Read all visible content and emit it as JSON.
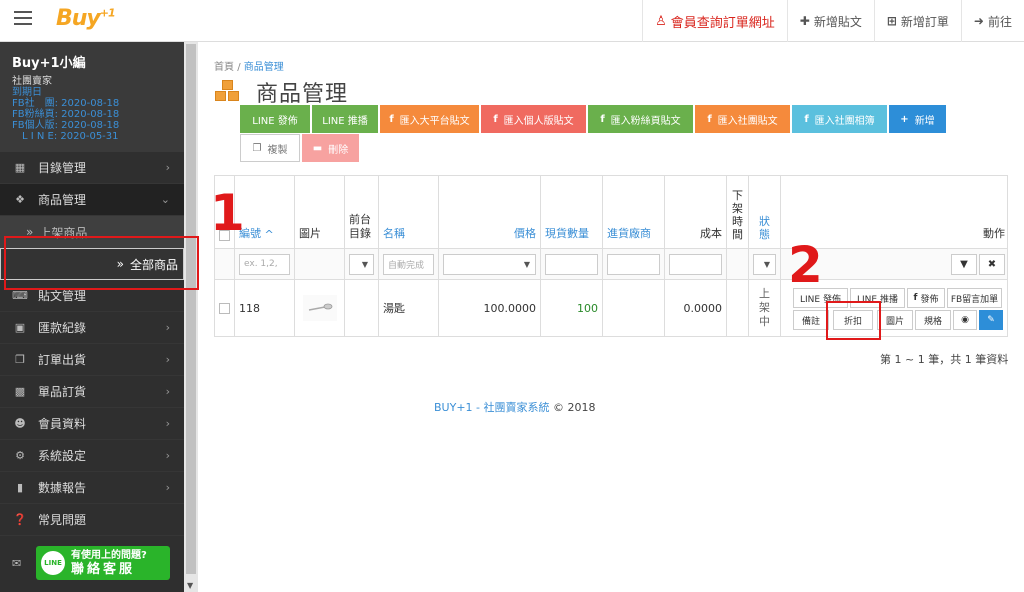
{
  "topbar": {
    "logo": "Buy",
    "logo_sup": "+1",
    "nav": [
      {
        "label": "會員查詢訂單網址",
        "icon": "person-icon"
      },
      {
        "label": "新增貼文",
        "icon": "plus-icon"
      },
      {
        "label": "新增訂單",
        "icon": "plus-square-icon"
      },
      {
        "label": "前往",
        "icon": "arrow-right-icon"
      }
    ]
  },
  "sidebar": {
    "profile": {
      "name": "Buy+1小編",
      "role": "社團賣家",
      "expiry_title": "到期日",
      "lines": [
        "FB社　團: 2020-08-18",
        "FB粉絲頁: 2020-08-18",
        "FB個人版: 2020-08-18",
        "　L I N E: 2020-05-31"
      ]
    },
    "menu": [
      {
        "label": "目錄管理",
        "icon": "table-icon"
      },
      {
        "label": "商品管理",
        "icon": "tag-icon"
      },
      {
        "label": "上架商品"
      },
      {
        "label": "全部商品"
      },
      {
        "label": "貼文管理",
        "icon": "keyboard-icon"
      },
      {
        "label": "匯款紀錄",
        "icon": "money-icon"
      },
      {
        "label": "訂單出貨",
        "icon": "copy-icon"
      },
      {
        "label": "單品訂貨",
        "icon": "gift-icon"
      },
      {
        "label": "會員資料",
        "icon": "user-icon"
      },
      {
        "label": "系統設定",
        "icon": "gear-icon"
      },
      {
        "label": "數據報告",
        "icon": "bar-chart-icon"
      },
      {
        "label": "常見問題",
        "icon": "question-icon"
      }
    ],
    "line_help": {
      "badge": "LINE",
      "line1": "有使用上的問題?",
      "line2": "聯絡客服"
    }
  },
  "main": {
    "breadcrumb": {
      "home": "首頁",
      "sep": "/",
      "current": "商品管理"
    },
    "title": "商品管理",
    "buttons_row1": [
      {
        "label": "LINE 發佈",
        "style": "g"
      },
      {
        "label": "LINE 推播",
        "style": "g"
      },
      {
        "label": "匯入大平台貼文",
        "style": "o"
      },
      {
        "label": "匯入個人版貼文",
        "style": "r"
      },
      {
        "label": "匯入粉絲頁貼文",
        "style": "g"
      },
      {
        "label": "匯入社團貼文",
        "style": "o"
      },
      {
        "label": "匯入社團相簿",
        "style": "c"
      },
      {
        "label": "新增",
        "style": "b"
      }
    ],
    "buttons_row2": [
      {
        "label": "複製"
      },
      {
        "label": "刪除"
      }
    ],
    "table": {
      "headers": [
        "編號",
        "圖片",
        "前台目錄",
        "名稱",
        "價格",
        "現貨數量",
        "進貨廠商",
        "成本",
        "下架時間",
        "狀態",
        "動作"
      ],
      "header_sort": "^",
      "filters": {
        "id_placeholder": "ex. 1,2,",
        "name_placeholder": "自動完成"
      },
      "rows": [
        {
          "id": "118",
          "name": "湯匙",
          "price": "100.0000",
          "stock": "100",
          "cost": "0.0000",
          "status": "上架中"
        }
      ],
      "actions": [
        "LINE 發佈",
        "LINE 推播",
        "發佈",
        "FB留言加單",
        "備註",
        "折扣",
        "圖片",
        "規格"
      ]
    },
    "pager": "第 1 ~ 1 筆，共 1 筆資料",
    "footer": {
      "brand": "BUY+1 - 社團賣家系統",
      "copyright": "© 2018"
    }
  },
  "annotations": {
    "num1": "1",
    "num2": "2"
  },
  "colors": {
    "accent_red": "#e0191a",
    "line_green": "#2ab42a",
    "brand_orange": "#f5a623",
    "link_blue": "#3b8fd6"
  }
}
